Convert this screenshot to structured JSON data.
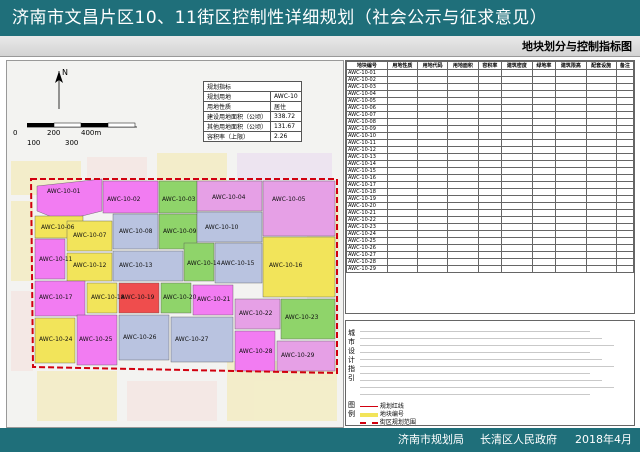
{
  "header": {
    "title": "济南市文昌片区10、11街区控制性详细规划（社会公示与征求意见）"
  },
  "subheader": {
    "title": "地块划分与控制指标图"
  },
  "colors": {
    "header_bg": "#1f6f7a",
    "residential": "#f2e45a",
    "commercial": "#ef4d4d",
    "education": "#f27cf2",
    "green": "#8fd46a",
    "admin": "#e6a0e6",
    "industrial": "#b9c3e0",
    "boundary": "#d1000f"
  },
  "map": {
    "scale_labels": [
      "0",
      "200",
      "400m",
      "100",
      "300"
    ],
    "north_label": "N",
    "summary_table": {
      "title": "规划指标",
      "rows": [
        [
          "规划用地",
          "AWC-10"
        ],
        [
          "用地性质",
          "居住"
        ],
        [
          "建设用地面积（公顷）",
          "338.72"
        ],
        [
          "其他用地面积（公顷）",
          "131.67"
        ],
        [
          "容积率（上限）",
          "2.26"
        ]
      ]
    },
    "parcels": [
      "AWC-10-01",
      "AWC-10-02",
      "AWC-10-03",
      "AWC-10-04",
      "AWC-10-05",
      "AWC-10-06",
      "AWC-10-07",
      "AWC-10-08",
      "AWC-10-09",
      "AWC-10-10",
      "AWC-10-11",
      "AWC-10-12",
      "AWC-10-13",
      "AWC-10-14",
      "AWC-10-15",
      "AWC-10-16",
      "AWC-10-17",
      "AWC-10-18",
      "AWC-10-19",
      "AWC-10-20",
      "AWC-10-21",
      "AWC-10-22",
      "AWC-10-23",
      "AWC-10-24",
      "AWC-10-25",
      "AWC-10-26",
      "AWC-10-27",
      "AWC-10-28",
      "AWC-10-29"
    ]
  },
  "table": {
    "headers": [
      "地块编号",
      "用地性质",
      "用地代码",
      "用地面积",
      "容积率",
      "建筑密度",
      "绿地率",
      "建筑限高",
      "配套设施",
      "备注"
    ]
  },
  "legend": {
    "side_labels": [
      "城市设计指引",
      "图例"
    ],
    "items": [
      "规划红线",
      "地块编号",
      "街区规划范围"
    ]
  },
  "footer": {
    "left": "济南市规划局",
    "mid": "长清区人民政府",
    "date": "2018年4月"
  }
}
